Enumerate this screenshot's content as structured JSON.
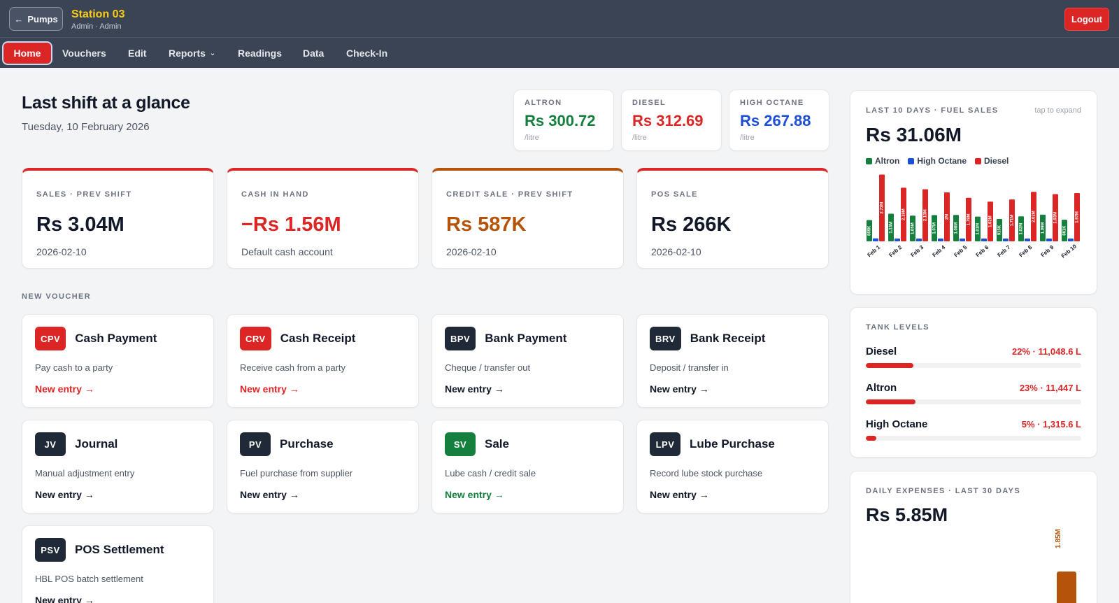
{
  "header": {
    "back_label": "Pumps",
    "station_name": "Station 03",
    "station_sub": "Admin · Admin",
    "logout_label": "Logout"
  },
  "nav": {
    "home": "Home",
    "vouchers": "Vouchers",
    "edit": "Edit",
    "reports": "Reports",
    "readings": "Readings",
    "data": "Data",
    "checkin": "Check-In"
  },
  "overview": {
    "title": "Last shift at a glance",
    "date": "Tuesday, 10 February 2026"
  },
  "prices": [
    {
      "label": "ALTRON",
      "value": "Rs 300.72",
      "unit": "/litre",
      "color": "#15803d"
    },
    {
      "label": "DIESEL",
      "value": "Rs 312.69",
      "unit": "/litre",
      "color": "#dc2626"
    },
    {
      "label": "HIGH OCTANE",
      "value": "Rs 267.88",
      "unit": "/litre",
      "color": "#1d4ed8"
    }
  ],
  "stats": [
    {
      "label": "SALES · PREV SHIFT",
      "value": "Rs 3.04M",
      "sub": "2026-02-10",
      "color": "#111827",
      "accent": "#dc2626"
    },
    {
      "label": "CASH IN HAND",
      "value": "−Rs 1.56M",
      "sub": "Default cash account",
      "color": "#dc2626",
      "accent": "#dc2626"
    },
    {
      "label": "CREDIT SALE · PREV SHIFT",
      "value": "Rs 587K",
      "sub": "2026-02-10",
      "color": "#b45309",
      "accent": "#b45309"
    },
    {
      "label": "POS SALE",
      "value": "Rs 266K",
      "sub": "2026-02-10",
      "color": "#111827",
      "accent": "#dc2626"
    }
  ],
  "new_voucher_label": "NEW VOUCHER",
  "vouchers": [
    {
      "code": "CPV",
      "title": "Cash Payment",
      "desc": "Pay cash to a party",
      "link": "New entry →",
      "badge_color": "#dc2626",
      "link_color": "#dc2626"
    },
    {
      "code": "CRV",
      "title": "Cash Receipt",
      "desc": "Receive cash from a party",
      "link": "New entry →",
      "badge_color": "#dc2626",
      "link_color": "#dc2626"
    },
    {
      "code": "BPV",
      "title": "Bank Payment",
      "desc": "Cheque / transfer out",
      "link": "New entry →",
      "badge_color": "#1f2937",
      "link_color": "#111827"
    },
    {
      "code": "BRV",
      "title": "Bank Receipt",
      "desc": "Deposit / transfer in",
      "link": "New entry →",
      "badge_color": "#1f2937",
      "link_color": "#111827"
    },
    {
      "code": "JV",
      "title": "Journal",
      "desc": "Manual adjustment entry",
      "link": "New entry →",
      "badge_color": "#1f2937",
      "link_color": "#111827"
    },
    {
      "code": "PV",
      "title": "Purchase",
      "desc": "Fuel purchase from supplier",
      "link": "New entry →",
      "badge_color": "#1f2937",
      "link_color": "#111827"
    },
    {
      "code": "SV",
      "title": "Sale",
      "desc": "Lube cash / credit sale",
      "link": "New entry →",
      "badge_color": "#15803d",
      "link_color": "#15803d"
    },
    {
      "code": "LPV",
      "title": "Lube Purchase",
      "desc": "Record lube stock purchase",
      "link": "New entry →",
      "badge_color": "#1f2937",
      "link_color": "#111827"
    },
    {
      "code": "PSV",
      "title": "POS Settlement",
      "desc": "HBL POS batch settlement",
      "link": "New entry →",
      "badge_color": "#1f2937",
      "link_color": "#111827"
    }
  ],
  "sales_panel": {
    "title": "LAST 10 DAYS · FUEL SALES",
    "hint": "tap to expand",
    "total": "Rs 31.06M"
  },
  "chart_data": {
    "type": "bar",
    "categories": [
      "Feb 1",
      "Feb 2",
      "Feb 3",
      "Feb 4",
      "Feb 5",
      "Feb 6",
      "Feb 7",
      "Feb 8",
      "Feb 9",
      "Feb 10"
    ],
    "series": [
      {
        "name": "Altron",
        "color": "#15803d",
        "values": [
          0.869,
          1.13,
          1.05,
          1.07,
          1.08,
          1.01,
          0.915,
          1.02,
          1.09,
          0.881
        ],
        "labels": [
          "869K",
          "1.13M",
          "1.05M",
          "1.07M",
          "1.08M",
          "1.01M",
          "915K",
          "1.02M",
          "1.09M",
          "881K"
        ]
      },
      {
        "name": "High Octane",
        "color": "#1d4ed8",
        "values": [
          0.123,
          0.065,
          0.042,
          0.061,
          0.097,
          0.085,
          0.054,
          0.068,
          0.085,
          0.089
        ],
        "labels": [
          "123K",
          "65K",
          "42K",
          "61K",
          "97K",
          "85K",
          "54K",
          "68K",
          "85K",
          "89K"
        ]
      },
      {
        "name": "Diesel",
        "color": "#dc2626",
        "values": [
          2.73,
          2.19,
          2.13,
          2.0,
          1.78,
          1.62,
          1.71,
          2.02,
          1.93,
          1.97
        ],
        "labels": [
          "2.73M",
          "2.19M",
          "2.13M",
          "2M",
          "1.78M",
          "1.62M",
          "1.71M",
          "2.02M",
          "1.93M",
          "1.97M"
        ]
      }
    ]
  },
  "tanks": {
    "title": "TANK LEVELS",
    "items": [
      {
        "name": "Diesel",
        "value": "22% · 11,048.6 L",
        "pct": 22
      },
      {
        "name": "Altron",
        "value": "23% · 11,447 L",
        "pct": 23
      },
      {
        "name": "High Octane",
        "value": "5% · 1,315.6 L",
        "pct": 5
      }
    ]
  },
  "expenses": {
    "title": "DAILY EXPENSES · LAST 30 DAYS",
    "total": "Rs 5.85M",
    "bar_label": "1.85M",
    "bar_color": "#b45309"
  }
}
